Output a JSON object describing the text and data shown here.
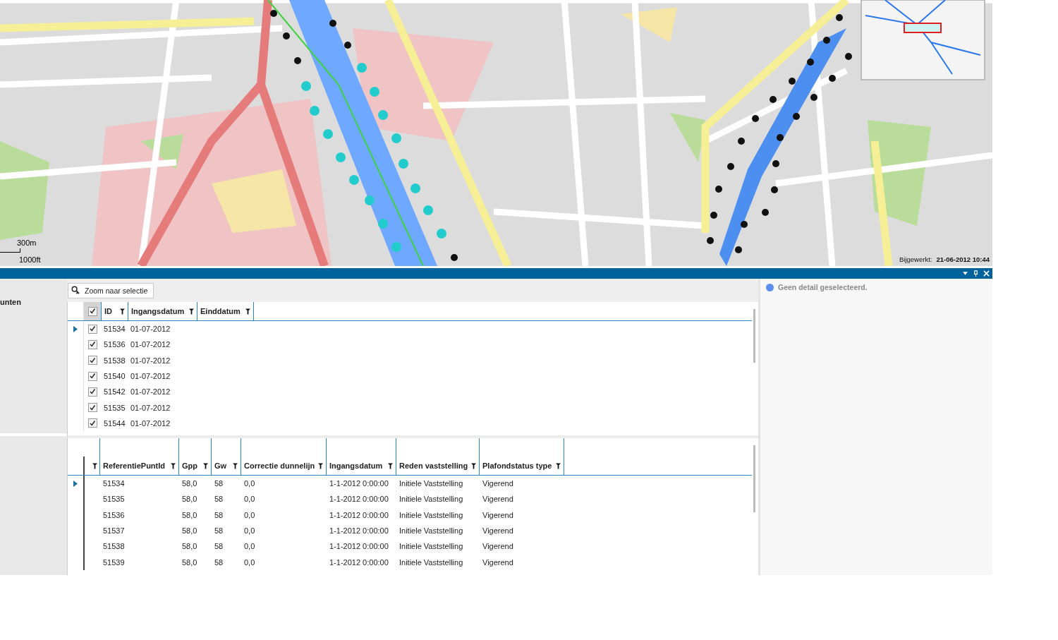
{
  "map": {
    "scale_metric": "300m",
    "scale_imperial": "1000ft",
    "updated_label": "Bijgewerkt:",
    "updated_value": "21-06-2012 10:44"
  },
  "sidebar": {
    "title": "unten"
  },
  "toolbar": {
    "zoom_button": "Zoom naar selectie"
  },
  "points_grid": {
    "header_checked": true,
    "columns": [
      "ID",
      "Ingangsdatum",
      "Einddatum"
    ],
    "rows": [
      {
        "id": "51534",
        "start": "01-07-2012",
        "checked": true,
        "selected": true
      },
      {
        "id": "51536",
        "start": "01-07-2012",
        "checked": true,
        "selected": false
      },
      {
        "id": "51538",
        "start": "01-07-2012",
        "checked": true,
        "selected": false
      },
      {
        "id": "51540",
        "start": "01-07-2012",
        "checked": true,
        "selected": false
      },
      {
        "id": "51542",
        "start": "01-07-2012",
        "checked": true,
        "selected": false
      },
      {
        "id": "51535",
        "start": "01-07-2012",
        "checked": true,
        "selected": false
      },
      {
        "id": "51544",
        "start": "01-07-2012",
        "checked": true,
        "selected": false
      }
    ]
  },
  "detail_grid": {
    "columns": [
      "ReferentiePuntId",
      "Gpp",
      "Gw",
      "Correctie dunnelijn",
      "Ingangsdatum",
      "Reden vaststelling",
      "Plafondstatus type"
    ],
    "rows": [
      {
        "cells": [
          "51534",
          "58,0",
          "58",
          "0,0",
          "1-1-2012 0:00:00",
          "Initiele Vaststelling",
          "Vigerend"
        ],
        "selected": true
      },
      {
        "cells": [
          "51535",
          "58,0",
          "58",
          "0,0",
          "1-1-2012 0:00:00",
          "Initiele Vaststelling",
          "Vigerend"
        ],
        "selected": false
      },
      {
        "cells": [
          "51536",
          "58,0",
          "58",
          "0,0",
          "1-1-2012 0:00:00",
          "Initiele Vaststelling",
          "Vigerend"
        ],
        "selected": false
      },
      {
        "cells": [
          "51537",
          "58,0",
          "58",
          "0,0",
          "1-1-2012 0:00:00",
          "Initiele Vaststelling",
          "Vigerend"
        ],
        "selected": false
      },
      {
        "cells": [
          "51538",
          "58,0",
          "58",
          "0,0",
          "1-1-2012 0:00:00",
          "Initiele Vaststelling",
          "Vigerend"
        ],
        "selected": false
      },
      {
        "cells": [
          "51539",
          "58,0",
          "58",
          "0,0",
          "1-1-2012 0:00:00",
          "Initiele Vaststelling",
          "Vigerend"
        ],
        "selected": false
      }
    ]
  },
  "detail_panel": {
    "message": "Geen detail geselecteerd."
  }
}
